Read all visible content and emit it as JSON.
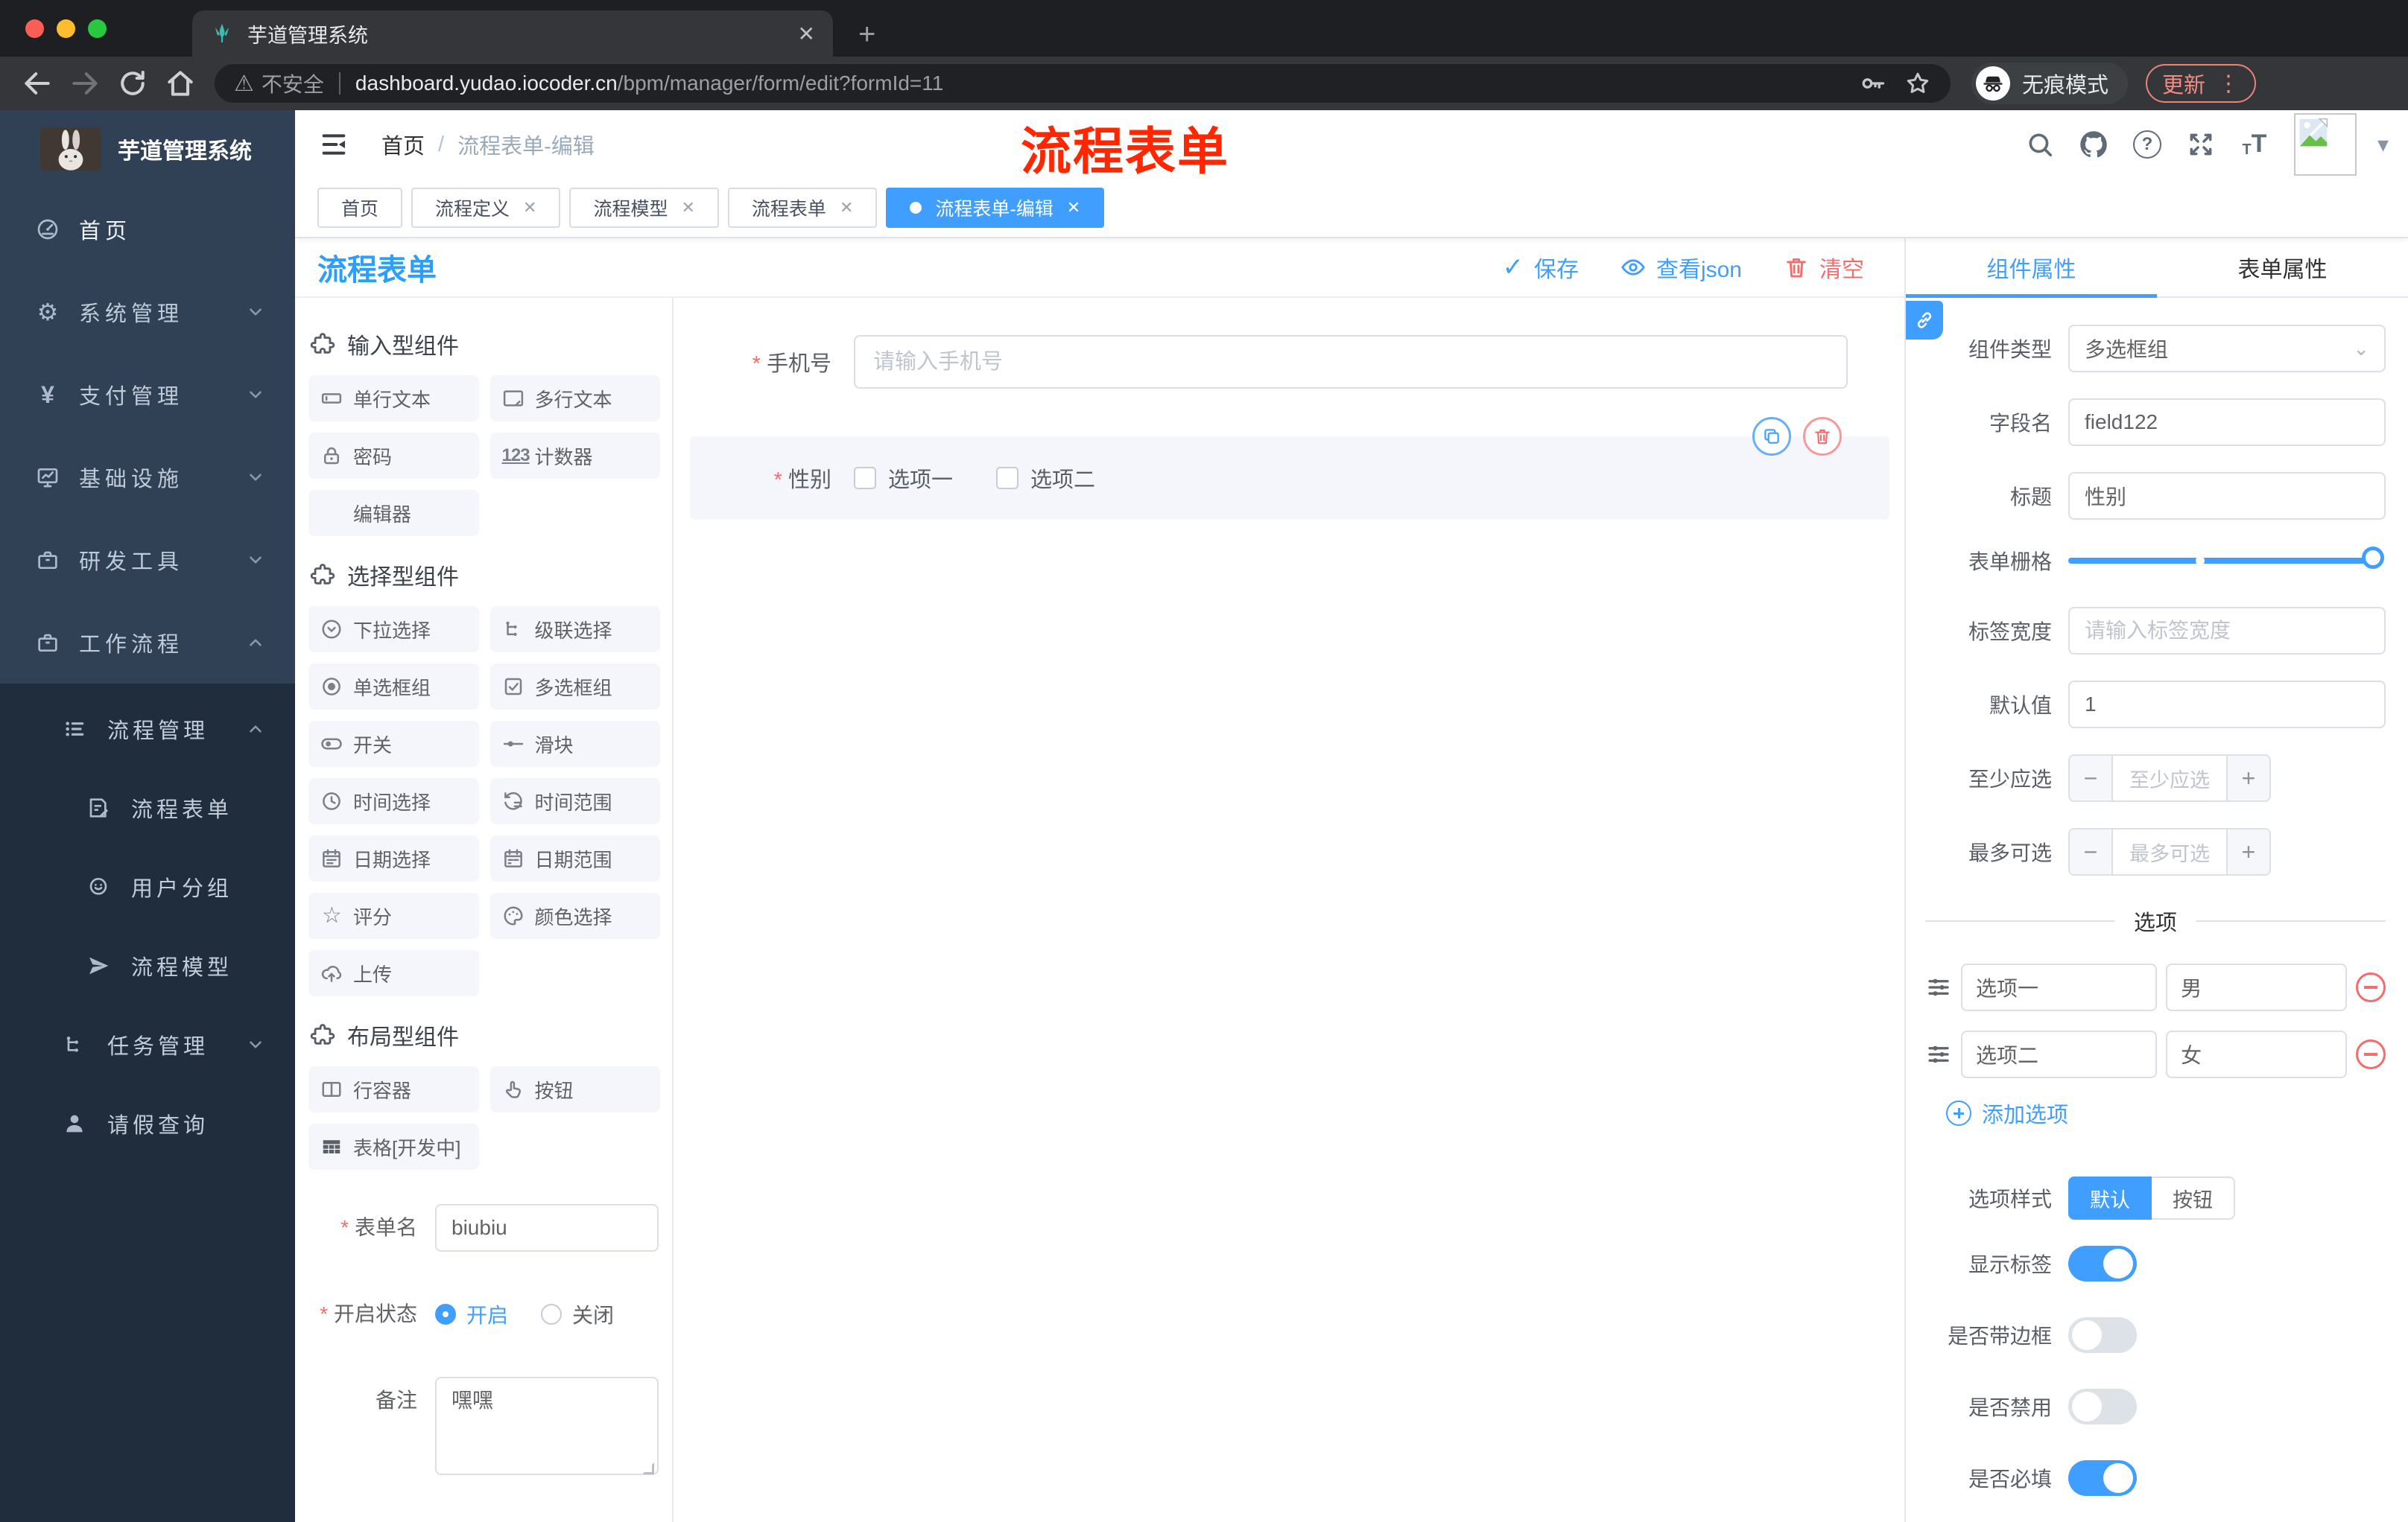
{
  "browser": {
    "tab_title": "芋道管理系统",
    "new_tab_glyph": "+",
    "security_label": "不安全",
    "url_host": "dashboard.yudao.iocoder.cn",
    "url_path": "/bpm/manager/form/edit?formId=11",
    "incognito_label": "无痕模式",
    "update_label": "更新"
  },
  "annotation": {
    "text": "流程表单"
  },
  "header": {
    "breadcrumb_home": "首页",
    "breadcrumb_current": "流程表单-编辑"
  },
  "view_tabs": [
    {
      "label": "首页"
    },
    {
      "label": "流程定义"
    },
    {
      "label": "流程模型"
    },
    {
      "label": "流程表单"
    },
    {
      "label": "流程表单-编辑"
    }
  ],
  "sidebar": {
    "logo_title": "芋道管理系统",
    "menu": [
      {
        "label": "首页"
      },
      {
        "label": "系统管理"
      },
      {
        "label": "支付管理"
      },
      {
        "label": "基础设施"
      },
      {
        "label": "研发工具"
      },
      {
        "label": "工作流程"
      }
    ],
    "submenu": [
      {
        "label": "流程管理"
      },
      {
        "label": "流程表单"
      },
      {
        "label": "用户分组"
      },
      {
        "label": "流程模型"
      },
      {
        "label": "任务管理"
      },
      {
        "label": "请假查询"
      }
    ]
  },
  "designer": {
    "title": "流程表单",
    "toolbar": {
      "save": "保存",
      "view_json": "查看json",
      "clear": "清空"
    }
  },
  "palette": {
    "sections": [
      {
        "title": "输入型组件",
        "items": [
          "单行文本",
          "多行文本",
          "密码",
          "计数器",
          "编辑器"
        ]
      },
      {
        "title": "选择型组件",
        "items": [
          "下拉选择",
          "级联选择",
          "单选框组",
          "多选框组",
          "开关",
          "滑块",
          "时间选择",
          "时间范围",
          "日期选择",
          "日期范围",
          "评分",
          "颜色选择",
          "上传"
        ]
      },
      {
        "title": "布局型组件",
        "items": [
          "行容器",
          "按钮",
          "表格[开发中]"
        ]
      }
    ]
  },
  "form_meta": {
    "name_label": "表单名",
    "name_value": "biubiu",
    "status_label": "开启状态",
    "status_on": "开启",
    "status_off": "关闭",
    "remark_label": "备注",
    "remark_value": "嘿嘿"
  },
  "canvas": {
    "phone": {
      "label": "手机号",
      "placeholder": "请输入手机号"
    },
    "gender": {
      "label": "性别",
      "option1": "选项一",
      "option2": "选项二"
    }
  },
  "props": {
    "tab_component": "组件属性",
    "tab_form": "表单属性",
    "component_type": {
      "label": "组件类型",
      "value": "多选框组"
    },
    "field_name": {
      "label": "字段名",
      "value": "field122"
    },
    "title": {
      "label": "标题",
      "value": "性别"
    },
    "grid": {
      "label": "表单栅格"
    },
    "label_width": {
      "label": "标签宽度",
      "placeholder": "请输入标签宽度"
    },
    "default_value": {
      "label": "默认值",
      "value": "1"
    },
    "min_select": {
      "label": "至少应选",
      "placeholder": "至少应选"
    },
    "max_select": {
      "label": "最多可选",
      "placeholder": "最多可选"
    },
    "options_divider": "选项",
    "options": [
      {
        "label": "选项一",
        "value": "男"
      },
      {
        "label": "选项二",
        "value": "女"
      }
    ],
    "add_option": "添加选项",
    "option_style": {
      "label": "选项样式",
      "choice_default": "默认",
      "choice_button": "按钮"
    },
    "switches": [
      {
        "label": "显示标签",
        "on": true
      },
      {
        "label": "是否带边框",
        "on": false
      },
      {
        "label": "是否禁用",
        "on": false
      },
      {
        "label": "是否必填",
        "on": true
      }
    ]
  },
  "colors": {
    "primary": "#409eff",
    "danger": "#f56c6c",
    "annotation_red": "#ff2600",
    "sidebar_bg": "#304156",
    "sidebar_sub_bg": "#1f2d3d"
  },
  "icons": {
    "browser": [
      "back-arrow",
      "forward-arrow",
      "reload",
      "home",
      "warning-triangle",
      "key",
      "star-outline",
      "incognito",
      "dots-vertical"
    ],
    "header": [
      "menu-fold",
      "search",
      "github",
      "question",
      "fullscreen",
      "font-size",
      "avatar-placeholder",
      "caret-down"
    ],
    "toolbar": [
      "check",
      "eye",
      "trash"
    ],
    "canvas_actions": [
      "copy",
      "trash"
    ],
    "props": [
      "chain-link",
      "drag-handle",
      "minus-circle",
      "plus-circle"
    ]
  }
}
